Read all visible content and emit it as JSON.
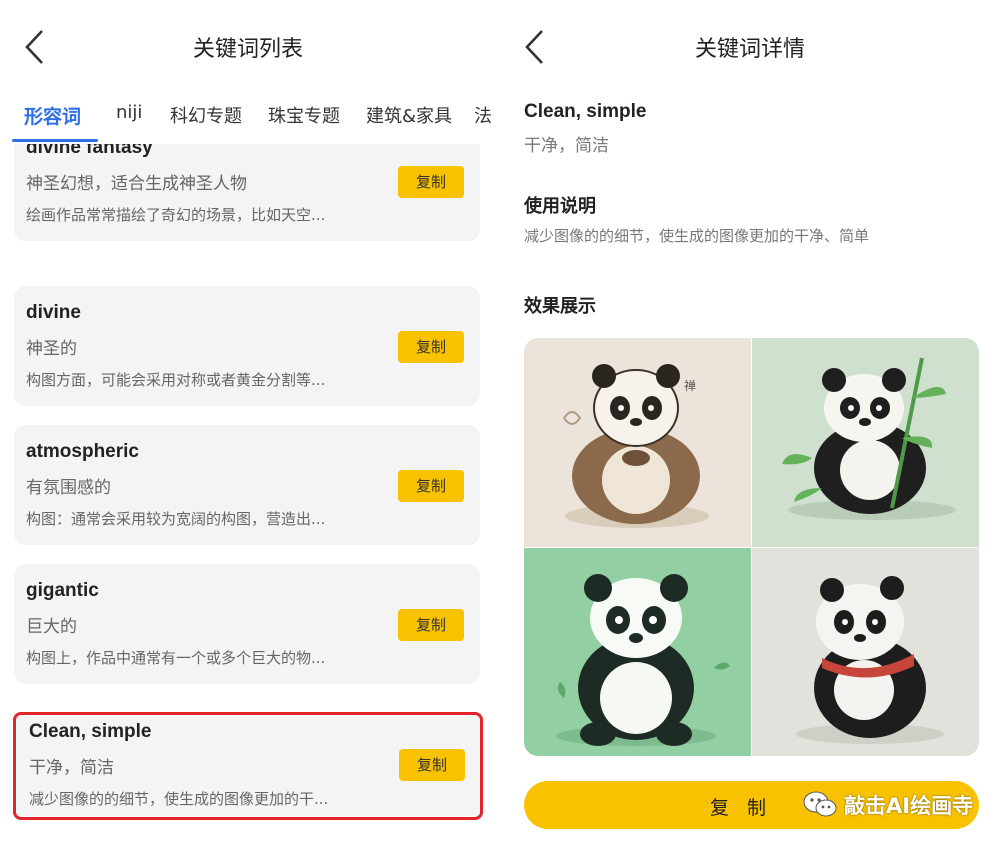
{
  "left": {
    "title": "关键词列表",
    "tabs": [
      {
        "label": "形容词",
        "active": true
      },
      {
        "label": "niji"
      },
      {
        "label": "科幻专题"
      },
      {
        "label": "珠宝专题"
      },
      {
        "label": "建筑&家具"
      },
      {
        "label": "法"
      }
    ],
    "cards": [
      {
        "keyword": "divine fantasy",
        "meaning": "神圣幻想，适合生成神圣人物",
        "desc": "绘画作品常常描绘了奇幻的场景，比如天空...",
        "copy_label": "复制"
      },
      {
        "keyword": "divine",
        "meaning": "神圣的",
        "desc": "构图方面，可能会采用对称或者黄金分割等...",
        "copy_label": "复制"
      },
      {
        "keyword": "atmospheric",
        "meaning": "有氛围感的",
        "desc": "构图：通常会采用较为宽阔的构图，营造出...",
        "copy_label": "复制"
      },
      {
        "keyword": "gigantic",
        "meaning": "巨大的",
        "desc": "构图上，作品中通常有一个或多个巨大的物...",
        "copy_label": "复制"
      },
      {
        "keyword": "Clean, simple",
        "meaning": "干净，简洁",
        "desc": "减少图像的的细节，使生成的图像更加的干...",
        "copy_label": "复制",
        "selected": true
      }
    ]
  },
  "right": {
    "title": "关键词详情",
    "keyword": "Clean, simple",
    "meaning": "干净，简洁",
    "usage_heading": "使用说明",
    "usage_text": "减少图像的的细节，使生成的图像更加的干净、简单",
    "showcase_heading": "效果展示",
    "copy_button_label": "复 制",
    "watermark": "敲击AI绘画寺",
    "images": [
      {
        "subject": "meditating panda in brown robe",
        "bg": "#ece4da"
      },
      {
        "subject": "panda holding bamboo",
        "bg": "#cfe0cf"
      },
      {
        "subject": "sitting panda",
        "bg": "#92cfa3"
      },
      {
        "subject": "panda with red scarf",
        "bg": "#e2e2dc"
      }
    ]
  },
  "colors": {
    "accent_blue": "#2f6fe4",
    "copy_yellow": "#f9c200",
    "card_bg": "#f4f4f4",
    "selection_red": "#e3242b"
  }
}
